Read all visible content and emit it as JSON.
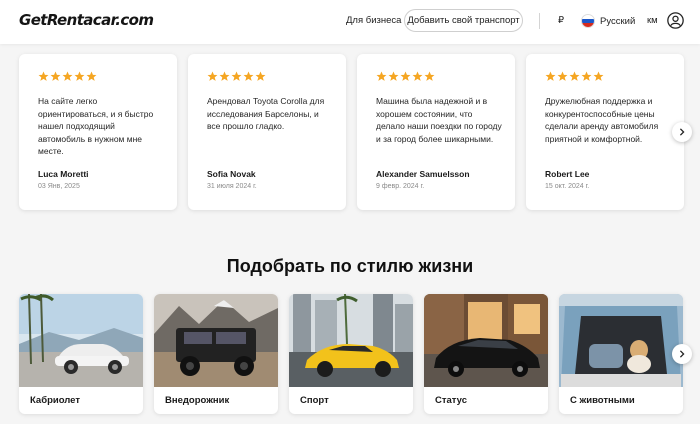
{
  "header": {
    "logo": "GetRentacar.com",
    "business_link": "Для бизнеса",
    "add_vehicle_button": "Добавить свой транспорт",
    "currency": "₽",
    "language": "Русский",
    "distance_unit": "км",
    "user_icon": "user-circle-icon"
  },
  "reviews": {
    "rating_icon": "star-icon",
    "star_color": "#f5a623",
    "items": [
      {
        "stars": 5,
        "text": "На сайте легко ориентироваться, и я быстро нашел подходящий автомобиль в нужном мне месте.",
        "author": "Luca Moretti",
        "date": "03 Янв, 2025"
      },
      {
        "stars": 5,
        "text": "Арендовал Toyota Corolla для исследования Барселоны, и все прошло гладко.",
        "author": "Sofia Novak",
        "date": "31 июля 2024 г."
      },
      {
        "stars": 5,
        "text": "Машина была надежной и в хорошем состоянии, что делало наши поездки по городу и за город более шикарными.",
        "author": "Alexander Samuelsson",
        "date": "9 февр. 2024 г."
      },
      {
        "stars": 5,
        "text": "Дружелюбная поддержка и конкурентоспособные цены сделали аренду автомобиля приятной и комфортной.",
        "author": "Robert Lee",
        "date": "15 окт. 2024 г."
      }
    ],
    "next_icon": "chevron-right-icon"
  },
  "lifestyle": {
    "title": "Подобрать по стилю жизни",
    "items": [
      {
        "label": "Кабриолет"
      },
      {
        "label": "Внедорожник"
      },
      {
        "label": "Спорт"
      },
      {
        "label": "Статус"
      },
      {
        "label": "С животными"
      }
    ],
    "next_icon": "chevron-right-icon"
  }
}
